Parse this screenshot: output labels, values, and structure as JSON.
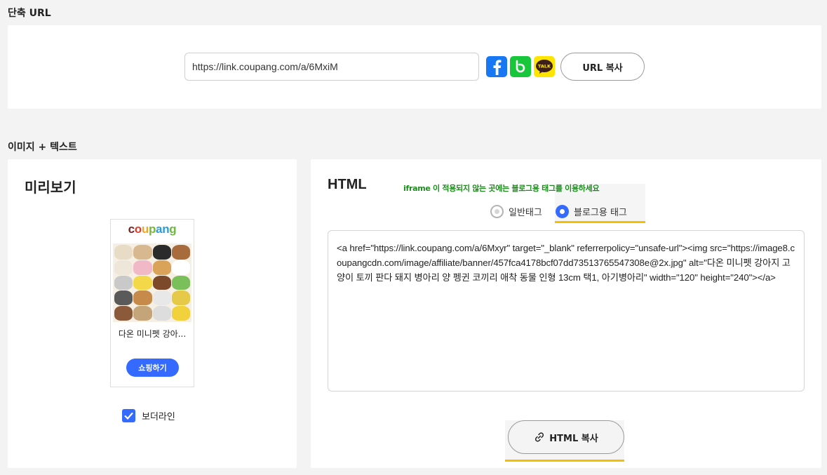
{
  "short_url": {
    "section_title": "단축 URL",
    "url_value": "https://link.coupang.com/a/6MxiM",
    "share_icons": [
      "facebook-icon",
      "band-icon",
      "kakaotalk-icon"
    ],
    "kakao_label": "TALK",
    "copy_label": "URL 복사"
  },
  "image_text": {
    "section_title": "이미지 + 텍스트"
  },
  "preview": {
    "title": "미리보기",
    "brand_letters": [
      "c",
      "o",
      "u",
      "p",
      "a",
      "n",
      "g"
    ],
    "brand_colors": [
      "#7b1f1f",
      "#e23b2e",
      "#f5a623",
      "#79b63a",
      "#2b9cd8",
      "#2b9cd8",
      "#6fb83c"
    ],
    "product_name": "다온 미니펫 강아...",
    "shop_button": "쇼핑하기",
    "border_line_label": "보더라인",
    "border_line_checked": true
  },
  "html_panel": {
    "title": "HTML",
    "tip": "iframe 이 적용되지 않는 곳에는 블로그용 태그를 이용하세요",
    "radio_general": "일반태그",
    "radio_blog": "블로그용 태그",
    "selected": "blog",
    "code": "<a href=\"https://link.coupang.com/a/6Mxyr\" target=\"_blank\" referrerpolicy=\"unsafe-url\"><img src=\"https://image8.coupangcdn.com/image/affiliate/banner/457fca4178bcf07dd73513765547308e@2x.jpg\" alt=\"다온 미니펫 강아지 고양이 토끼 판다 돼지 병아리 양 펭귄 코끼리 애착 동물 인형 13cm 택1, 아기병아리\" width=\"120\" height=\"240\"></a>",
    "copy_label": "HTML 복사"
  },
  "colors": {
    "accent": "#346aff",
    "highlight": "#f5bf00",
    "tip_green": "#1e8a1e"
  }
}
